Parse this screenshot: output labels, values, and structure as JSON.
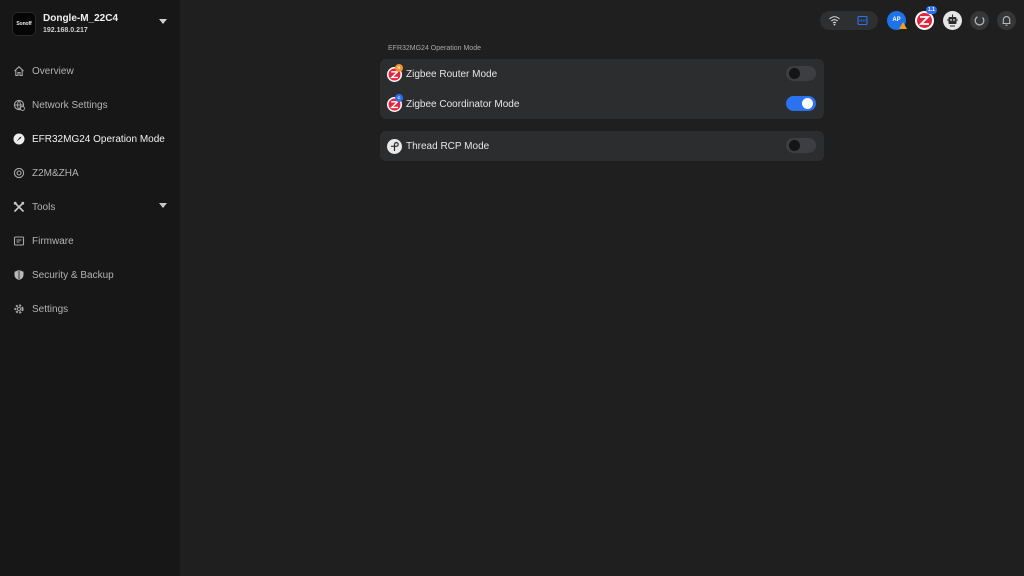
{
  "device": {
    "logo_text": "Sonoff",
    "name": "Dongle-M_22C4",
    "ip": "192.168.0.217"
  },
  "nav": {
    "items": [
      {
        "label": "Overview",
        "icon": "home-icon"
      },
      {
        "label": "Network Settings",
        "icon": "network-icon"
      },
      {
        "label": "EFR32MG24 Operation Mode",
        "icon": "compass-icon",
        "active": true
      },
      {
        "label": "Z2M&ZHA",
        "icon": "target-icon"
      },
      {
        "label": "Tools",
        "icon": "tools-icon",
        "expandable": true
      },
      {
        "label": "Firmware",
        "icon": "firmware-icon"
      },
      {
        "label": "Security & Backup",
        "icon": "shield-icon"
      },
      {
        "label": "Settings",
        "icon": "gear-icon"
      }
    ]
  },
  "topbar": {
    "status_icons": [
      "wifi-icon",
      "ethernet-icon"
    ],
    "ap_label": "AP",
    "zigbee_badge": "1.1",
    "buttons": [
      "ap-status-icon",
      "zigbee-status-icon",
      "robot-icon",
      "power-icon",
      "bell-icon"
    ]
  },
  "main": {
    "section_title": "EFR32MG24 Operation Mode",
    "modes": [
      {
        "label": "Zigbee Router Mode",
        "badge": "R",
        "enabled": false
      },
      {
        "label": "Zigbee Coordinator Mode",
        "badge": "C",
        "enabled": true
      },
      {
        "label": "Thread RCP Mode",
        "badge": "",
        "enabled": false
      }
    ]
  },
  "colors": {
    "accent": "#2a72f0",
    "sidebar_bg": "#171718",
    "main_bg": "#1f1f20",
    "card_bg": "#2c2d2f"
  }
}
